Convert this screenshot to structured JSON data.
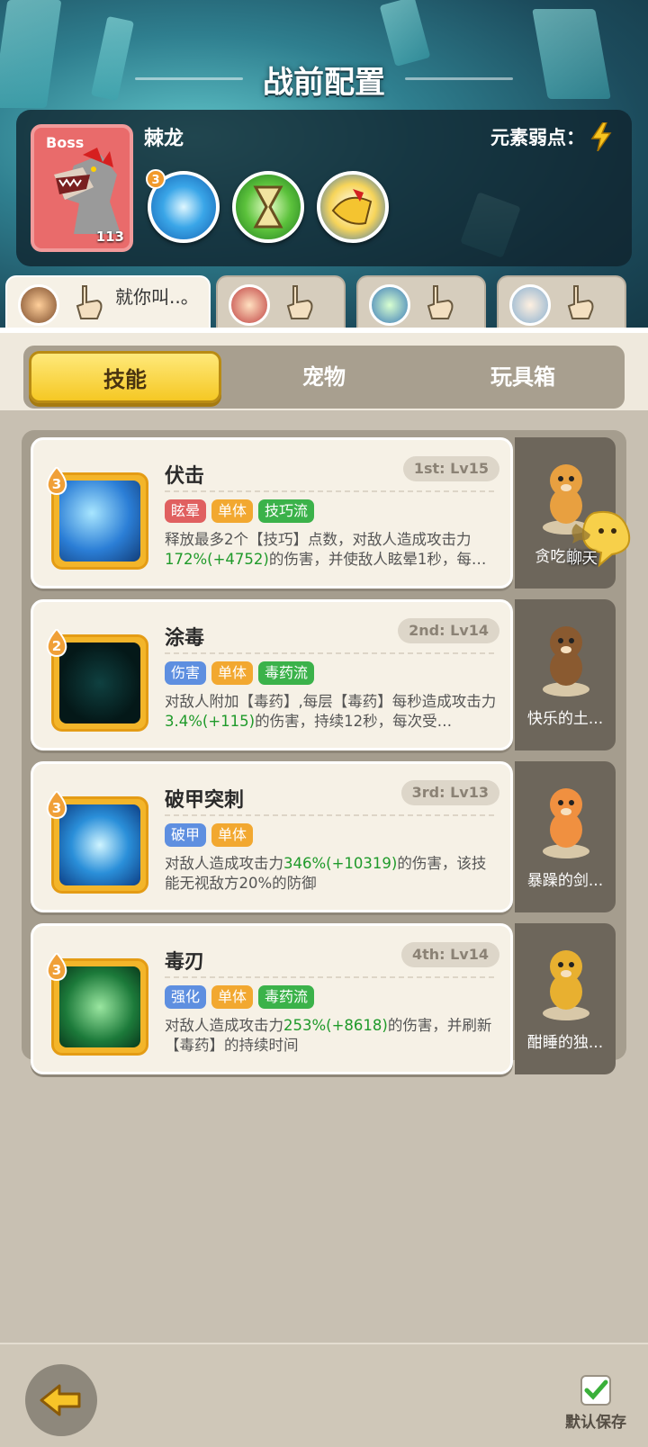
{
  "title": "战前配置",
  "boss": {
    "tag": "Boss",
    "level": "113",
    "name": "棘龙",
    "weakness_label": "元素弱点：",
    "weakness_icon": "lightning-icon",
    "skill_badge": "3"
  },
  "heroes": [
    {
      "name": "就你叫..。",
      "active": true
    },
    {
      "name": "",
      "active": false
    },
    {
      "name": "",
      "active": false
    },
    {
      "name": "",
      "active": false
    }
  ],
  "tabs": [
    "技能",
    "宠物",
    "玩具箱"
  ],
  "active_tab": "技能",
  "skills": [
    {
      "level": "3",
      "name": "伏击",
      "rank": "1st: Lv15",
      "tags": [
        {
          "t": "眩晕",
          "c": "#e06060"
        },
        {
          "t": "单体",
          "c": "#f2a830"
        },
        {
          "t": "技巧流",
          "c": "#3bb24a"
        }
      ],
      "desc": [
        "释放最多2个【技巧】点数，对敌人造成攻击力",
        "172%",
        "(+4752)",
        "的伤害，并使敌人眩晕1秒，每…"
      ],
      "pet": "贪吃的..."
    },
    {
      "level": "2",
      "name": "涂毒",
      "rank": "2nd: Lv14",
      "tags": [
        {
          "t": "伤害",
          "c": "#5e8fe0"
        },
        {
          "t": "单体",
          "c": "#f2a830"
        },
        {
          "t": "毒药流",
          "c": "#3bb24a"
        }
      ],
      "desc": [
        "对敌人附加【毒药】,每层【毒药】每秒造成攻击力",
        "3.4%",
        "(+115)",
        "的伤害，持续12秒，每次受…"
      ],
      "pet": "快乐的土..."
    },
    {
      "level": "3",
      "name": "破甲突刺",
      "rank": "3rd: Lv13",
      "tags": [
        {
          "t": "破甲",
          "c": "#5e8fe0"
        },
        {
          "t": "单体",
          "c": "#f2a830"
        }
      ],
      "desc": [
        "对敌人造成攻击力",
        "346%",
        "(+10319)",
        "的伤害，该技能无视敌方20%的防御"
      ],
      "pet": "暴躁的剑..."
    },
    {
      "level": "3",
      "name": "毒刃",
      "rank": "4th: Lv14",
      "tags": [
        {
          "t": "强化",
          "c": "#5e8fe0"
        },
        {
          "t": "单体",
          "c": "#f2a830"
        },
        {
          "t": "毒药流",
          "c": "#3bb24a"
        }
      ],
      "desc": [
        "对敌人造成攻击力",
        "253%",
        "(+8618)",
        "的伤害，并刷新【毒药】的持续时间"
      ],
      "pet": "酣睡的独..."
    }
  ],
  "chat_label": "聊天",
  "save_label": "默认保存"
}
